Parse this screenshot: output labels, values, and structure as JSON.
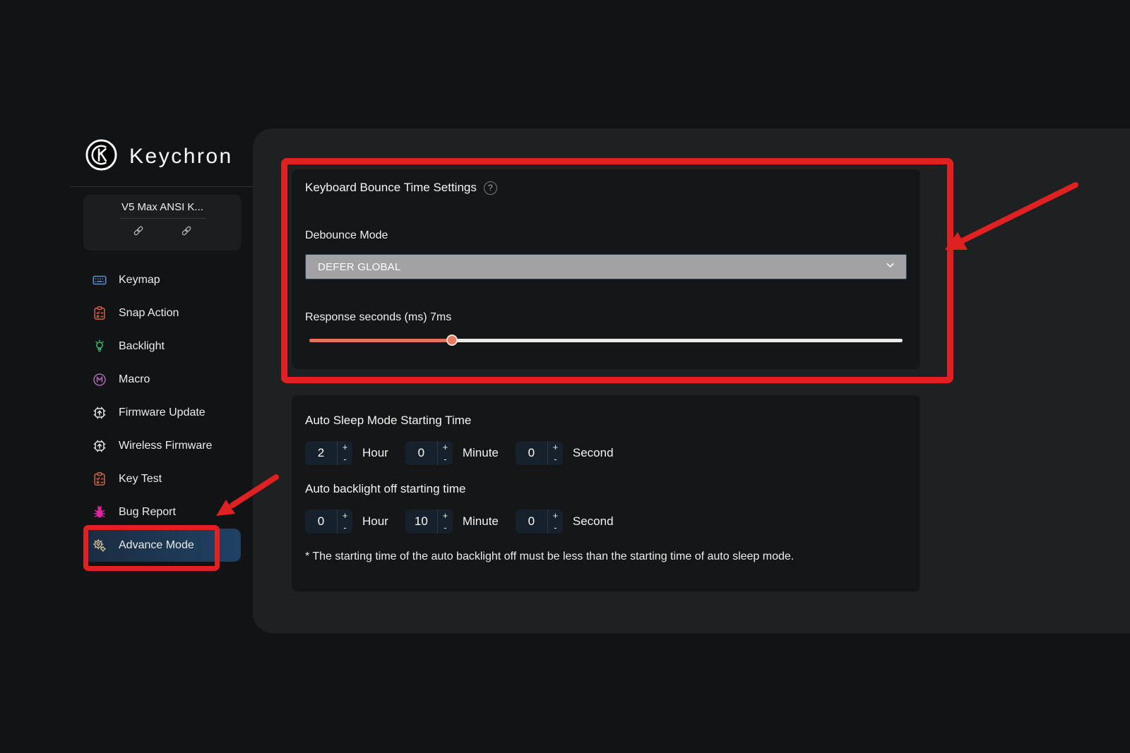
{
  "brand": {
    "logo_text": "Keychron"
  },
  "sidebar": {
    "device": {
      "name": "V5 Max ANSI K..."
    },
    "items": [
      {
        "label": "Keymap",
        "icon": "keyboard-icon",
        "icon_color": "#5b8fd9",
        "selected": false
      },
      {
        "label": "Snap Action",
        "icon": "clipboard-icon",
        "icon_color": "#cf5f3c",
        "selected": false
      },
      {
        "label": "Backlight",
        "icon": "bulb-icon",
        "icon_color": "#3fba70",
        "selected": false
      },
      {
        "label": "Macro",
        "icon": "macro-m-icon",
        "icon_color": "#b671bd",
        "selected": false
      },
      {
        "label": "Firmware Update",
        "icon": "chip-upload-icon",
        "icon_color": "#e8e8e8",
        "selected": false
      },
      {
        "label": "Wireless Firmware",
        "icon": "chip-upload-icon",
        "icon_color": "#e8e8e8",
        "selected": false
      },
      {
        "label": "Key Test",
        "icon": "clipboard-icon",
        "icon_color": "#cf5f3c",
        "selected": false
      },
      {
        "label": "Bug Report",
        "icon": "bug-icon",
        "icon_color": "#e3219f",
        "selected": false
      },
      {
        "label": "Advance Mode",
        "icon": "gear-bulb-icon",
        "icon_color": "#cfc193",
        "selected": true
      }
    ]
  },
  "main": {
    "bounce_card": {
      "title": "Keyboard Bounce Time Settings",
      "help_glyph": "?",
      "debounce_label": "Debounce Mode",
      "debounce_value": "DEFER GLOBAL",
      "response_label": "Response seconds (ms) 7ms",
      "slider": {
        "value_ms": 7,
        "fill_percent": 24,
        "fill_color": "#e2725a",
        "track_color": "#eaeaea"
      }
    },
    "sleep_card": {
      "sleep_title": "Auto Sleep Mode Starting Time",
      "sleep_time": {
        "hour": "2",
        "minute": "0",
        "second": "0"
      },
      "backlight_title": "Auto backlight off starting time",
      "backlight_time": {
        "hour": "0",
        "minute": "10",
        "second": "0"
      },
      "note": "* The starting time of the auto backlight off must be less than the starting time of auto sleep mode."
    },
    "units": {
      "hour": "Hour",
      "minute": "Minute",
      "second": "Second"
    },
    "stepper": {
      "plus": "+",
      "minus": "-"
    }
  },
  "annotations": {
    "color": "#e02121",
    "highlighted_regions": [
      "Keyboard Bounce Time Settings card",
      "Advance Mode sidebar item"
    ]
  },
  "colors": {
    "page_bg": "#121315",
    "panel_bg": "#1e2021",
    "card_bg": "#141617",
    "selected_item_bg": "#1f4263",
    "dropdown_bg": "#a2a2a4",
    "stepper_bg": "#16212c"
  }
}
